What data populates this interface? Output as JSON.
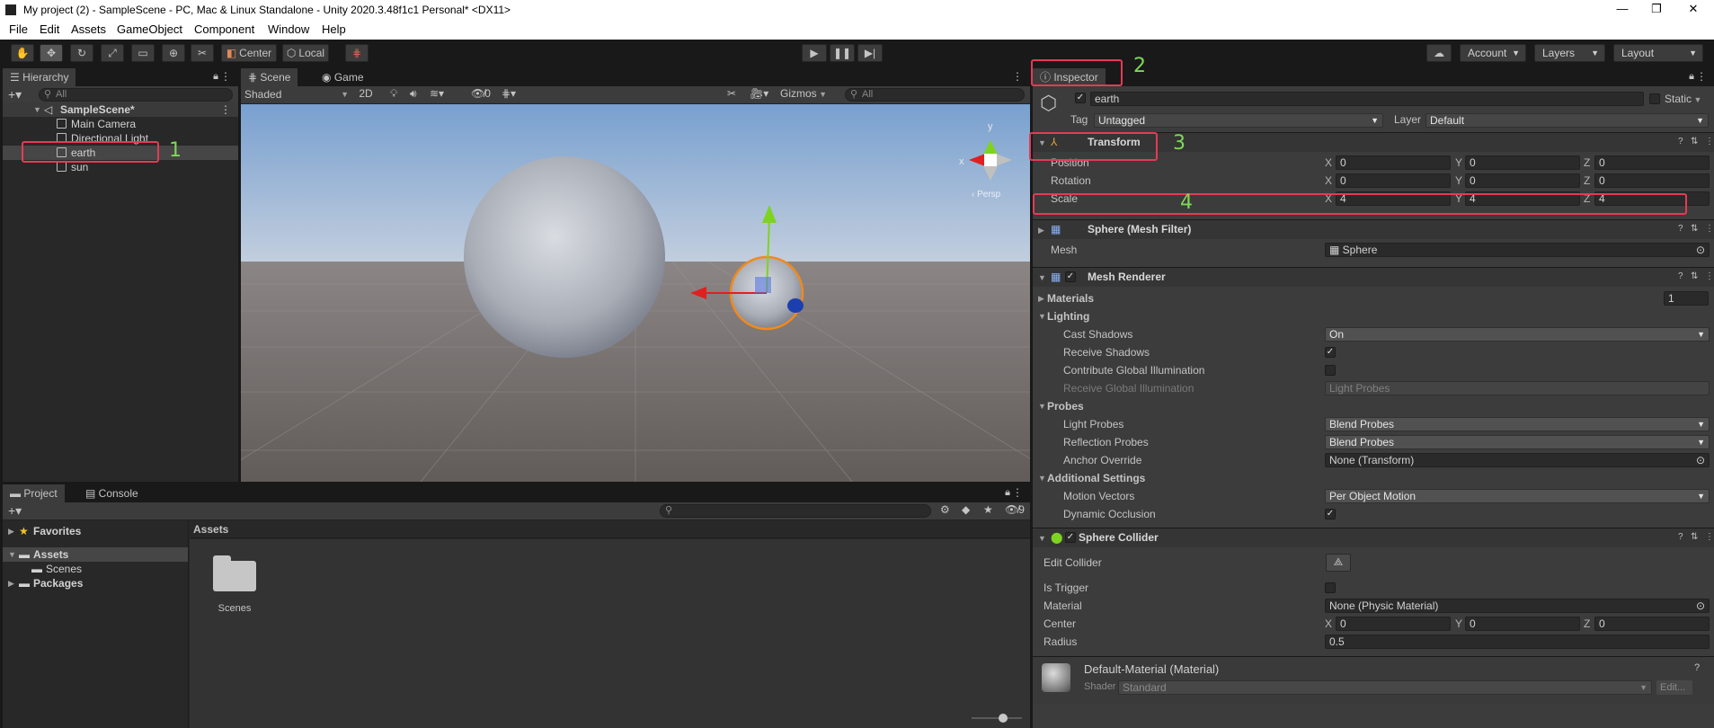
{
  "window": {
    "title": "My project (2) - SampleScene - PC, Mac & Linux Standalone - Unity 2020.3.48f1c1 Personal* <DX11>"
  },
  "menu": [
    "File",
    "Edit",
    "Assets",
    "GameObject",
    "Component",
    "Window",
    "Help"
  ],
  "toolbar": {
    "pivot": "Center",
    "space": "Local",
    "account": "Account",
    "layers": "Layers",
    "layout": "Layout"
  },
  "hierarchy": {
    "tab": "Hierarchy",
    "search_placeholder": "All",
    "scene": "SampleScene*",
    "items": [
      "Main Camera",
      "Directional Light",
      "earth",
      "sun"
    ]
  },
  "scene_view": {
    "tabs": [
      "Scene",
      "Game"
    ],
    "shading": "Shaded",
    "mode_2d": "2D",
    "hidden_count": "0",
    "gizmos": "Gizmos",
    "search_placeholder": "All",
    "view_label": "‹ Persp",
    "axis_y": "y",
    "axis_x": "x"
  },
  "project": {
    "tabs": [
      "Project",
      "Console"
    ],
    "favorites": "Favorites",
    "assets": "Assets",
    "scenes": "Scenes",
    "packages": "Packages",
    "breadcrumb": "Assets",
    "folder_name": "Scenes",
    "hidden_count": "9"
  },
  "inspector": {
    "tab": "Inspector",
    "object_name": "earth",
    "static_label": "Static",
    "tag_label": "Tag",
    "tag_value": "Untagged",
    "layer_label": "Layer",
    "layer_value": "Default",
    "transform": {
      "title": "Transform",
      "rows": [
        {
          "label": "Position",
          "x": "0",
          "y": "0",
          "z": "0"
        },
        {
          "label": "Rotation",
          "x": "0",
          "y": "0",
          "z": "0"
        },
        {
          "label": "Scale",
          "x": "4",
          "y": "4",
          "z": "4"
        }
      ]
    },
    "mesh_filter": {
      "title": "Sphere (Mesh Filter)",
      "mesh_label": "Mesh",
      "mesh_value": "Sphere"
    },
    "mesh_renderer": {
      "title": "Mesh Renderer",
      "materials_label": "Materials",
      "materials_count": "1",
      "lighting": "Lighting",
      "cast_shadows": "Cast Shadows",
      "cast_shadows_value": "On",
      "receive_shadows": "Receive Shadows",
      "contribute_gi": "Contribute Global Illumination",
      "receive_gi": "Receive Global Illumination",
      "receive_gi_value": "Light Probes",
      "probes": "Probes",
      "light_probes": "Light Probes",
      "light_probes_value": "Blend Probes",
      "reflection_probes": "Reflection Probes",
      "reflection_probes_value": "Blend Probes",
      "anchor_override": "Anchor Override",
      "anchor_override_value": "None (Transform)",
      "additional_settings": "Additional Settings",
      "motion_vectors": "Motion Vectors",
      "motion_vectors_value": "Per Object Motion",
      "dynamic_occlusion": "Dynamic Occlusion"
    },
    "sphere_collider": {
      "title": "Sphere Collider",
      "edit_collider": "Edit Collider",
      "is_trigger": "Is Trigger",
      "material_label": "Material",
      "material_value": "None (Physic Material)",
      "center_label": "Center",
      "center": {
        "x": "0",
        "y": "0",
        "z": "0"
      },
      "radius_label": "Radius",
      "radius_value": "0.5"
    },
    "material": {
      "title": "Default-Material (Material)",
      "shader_label": "Shader",
      "shader_value": "Standard",
      "edit_label": "Edit..."
    }
  },
  "annotations": [
    "1",
    "2",
    "3",
    "4"
  ]
}
